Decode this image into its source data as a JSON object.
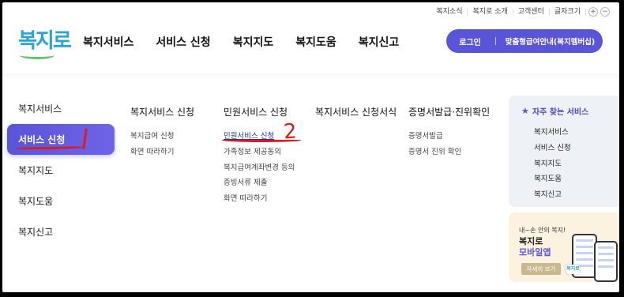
{
  "utility_links": [
    "복지소식",
    "복지로 소개",
    "고객센터",
    "글자크기"
  ],
  "zoom": {
    "plus": "+",
    "minus": "−"
  },
  "logo": {
    "text": "복지로"
  },
  "gnb": [
    "복지서비스",
    "서비스 신청",
    "복지지도",
    "복지도움",
    "복지신고"
  ],
  "login_bar": {
    "login": "로그인",
    "guide": "맞춤형급여안내(복지멤버십)"
  },
  "side_menu": [
    {
      "label": "복지서비스"
    },
    {
      "label": "서비스 신청"
    },
    {
      "label": "복지지도"
    },
    {
      "label": "복지도움"
    },
    {
      "label": "복지신고"
    }
  ],
  "columns": [
    {
      "title": "복지서비스 신청",
      "items": [
        "복지급여 신청",
        "화면 따라하기"
      ]
    },
    {
      "title": "민원서비스 신청",
      "items": [
        "민원서비스 신청",
        "가족정보 제공동의",
        "복지급여계좌변경 등의",
        "증빙서류 제출",
        "화면 따라하기"
      ]
    },
    {
      "title": "복지서비스 신청서식",
      "items": []
    },
    {
      "title": "증명서발급·진위확인",
      "items": [
        "증명서발급",
        "증명서 진위 확인"
      ]
    }
  ],
  "annotations": {
    "mark1": "1",
    "mark2": "2"
  },
  "favorites": {
    "title": "자주 찾는 서비스",
    "items": [
      "복지서비스",
      "서비스 신청",
      "복지지도",
      "복지도움",
      "복지신고"
    ]
  },
  "app_banner": {
    "small": "내~손 안의 복지!",
    "line1": "복지로",
    "line2": "모바일앱",
    "button": "자세히 보기",
    "app_icon_text": "복지로"
  },
  "colors": {
    "accent": "#5a54d8",
    "logo_blue": "#2aa3d6",
    "annotation_red": "#e01a1a"
  }
}
